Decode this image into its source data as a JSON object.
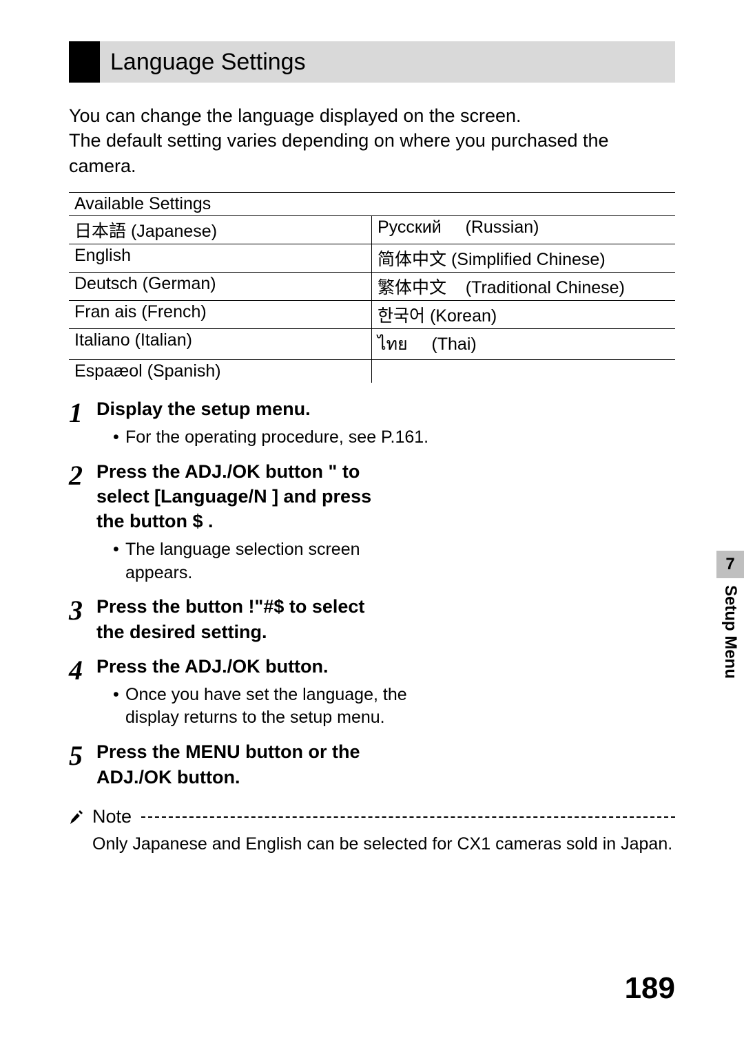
{
  "title": "Language Settings",
  "intro": "You can change the language displayed on the screen.\nThe default setting varies depending on where you purchased the camera.",
  "table": {
    "header": "Available Settings",
    "rows": [
      {
        "left": "日本語 (Japanese)",
        "right": "Русский     (Russian)"
      },
      {
        "left": "English",
        "right": "简体中文 (Simplified Chinese)"
      },
      {
        "left": "Deutsch (German)",
        "right": "繁体中文    (Traditional Chinese)"
      },
      {
        "left": "Fran ais (French)",
        "right": "한국어 (Korean)"
      },
      {
        "left": "Italiano (Italian)",
        "right": "ไทย     (Thai)"
      },
      {
        "left": "Espaæol (Spanish)",
        "right": ""
      }
    ]
  },
  "steps": [
    {
      "num": "1",
      "title": "Display the setup menu.",
      "bullets": [
        "For the operating procedure, see P.161."
      ],
      "narrow": false
    },
    {
      "num": "2",
      "title": "Press the ADJ./OK button \"   to select [Language/N     ] and press the button $ .",
      "bullets": [
        "The language selection screen appears."
      ],
      "narrow": true
    },
    {
      "num": "3",
      "title": "Press the button !\"#$      to select the desired setting.",
      "bullets": [],
      "narrow": true
    },
    {
      "num": "4",
      "title": "Press the ADJ./OK button.",
      "bullets": [
        "Once you have set the language, the display returns to the setup menu."
      ],
      "narrow": true
    },
    {
      "num": "5",
      "title": "Press the MENU button or the ADJ./OK button.",
      "bullets": [],
      "narrow": true
    }
  ],
  "note": {
    "label": "Note",
    "text": "Only Japanese and English can be selected for CX1 cameras sold in Japan."
  },
  "side": {
    "chapter_num": "7",
    "chapter_title": "Setup Menu"
  },
  "page_number": "189"
}
